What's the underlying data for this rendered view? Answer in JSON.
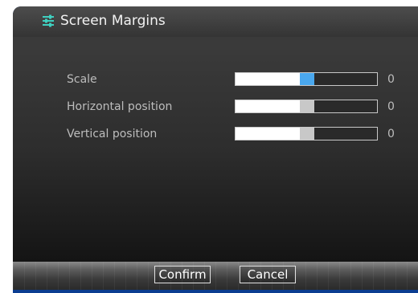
{
  "window": {
    "title": "Screen Margins",
    "icon": "sliders-icon"
  },
  "settings": [
    {
      "label": "Scale",
      "value": "0",
      "level": 0.5,
      "active": true
    },
    {
      "label": "Horizontal position",
      "value": "0",
      "level": 0.5,
      "active": false
    },
    {
      "label": "Vertical position",
      "value": "0",
      "level": 0.5,
      "active": false
    }
  ],
  "footer": {
    "confirm_label": "Confirm",
    "cancel_label": "Cancel"
  },
  "colors": {
    "accent": "#4aa8ef",
    "thumb_inactive": "#c8c8c8",
    "icon": "#3fd0c0",
    "border_accent": "#0b3d91"
  }
}
